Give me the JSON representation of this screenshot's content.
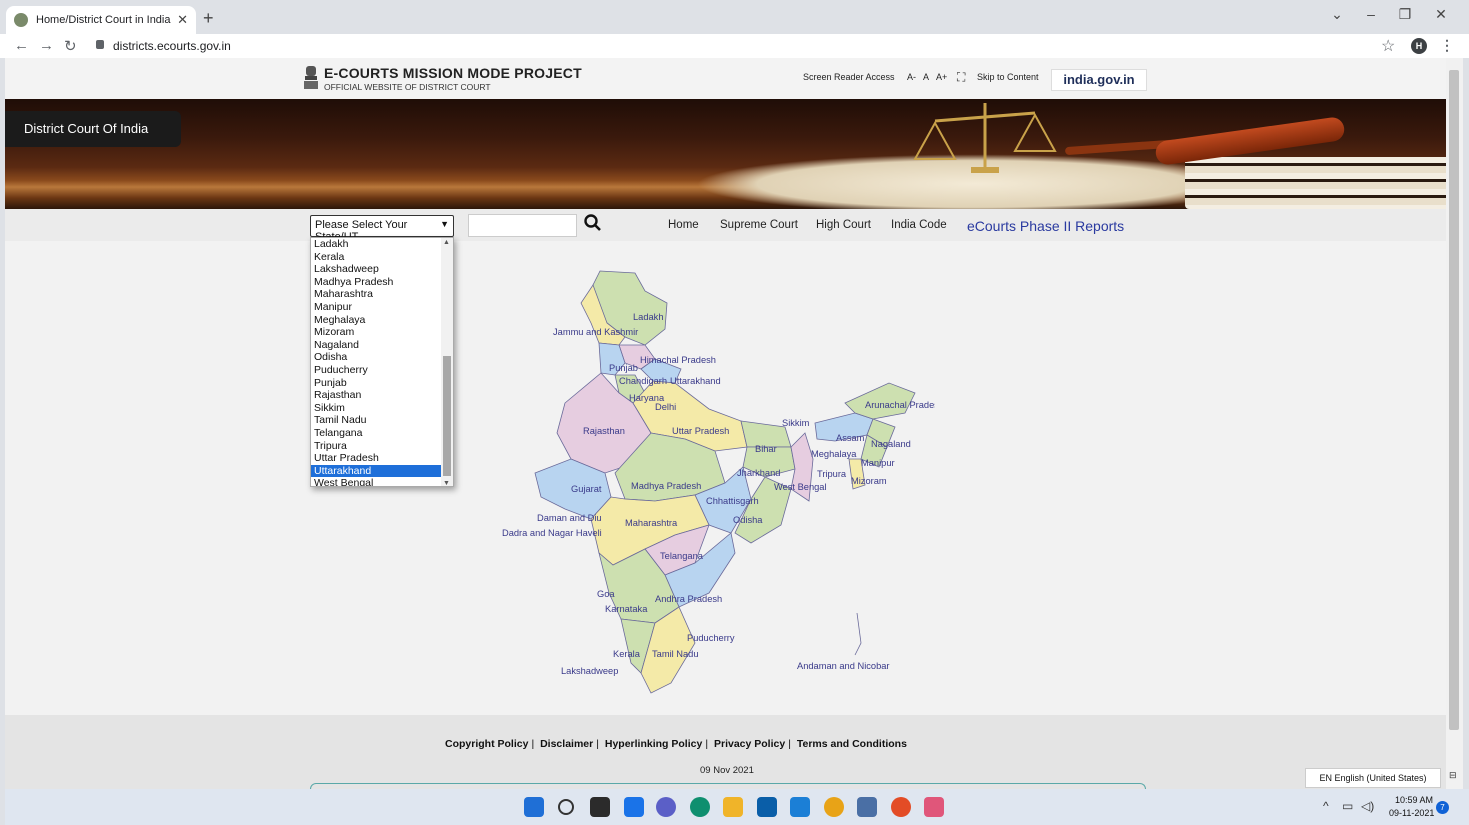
{
  "browser": {
    "tab_title": "Home/District Court in India | Of",
    "tab_close": "✕",
    "new_tab": "+",
    "url": "districts.ecourts.gov.in",
    "profile_initial": "H",
    "window_controls": [
      "⌄",
      "–",
      "❐",
      "✕"
    ]
  },
  "header": {
    "title": "E-COURTS MISSION MODE PROJECT",
    "subtitle": "OFFICIAL WEBSITE OF DISTRICT COURT",
    "screen_reader": "Screen Reader Access",
    "font_small": "A-",
    "font_normal": "A",
    "font_large": "A+",
    "skip_content": "Skip to Content",
    "india_gov": "india.gov.in"
  },
  "banner": {
    "title": "District Court Of India"
  },
  "nav": {
    "state_select": "Please Select Your State/UT",
    "search_placeholder": "",
    "links": [
      "Home",
      "Supreme Court",
      "High Court",
      "India Code"
    ],
    "reports": "eCourts Phase II Reports"
  },
  "dropdown": {
    "options": [
      "Ladakh",
      "Kerala",
      "Lakshadweep",
      "Madhya Pradesh",
      "Maharashtra",
      "Manipur",
      "Meghalaya",
      "Mizoram",
      "Nagaland",
      "Odisha",
      "Puducherry",
      "Punjab",
      "Rajasthan",
      "Sikkim",
      "Tamil Nadu",
      "Telangana",
      "Tripura",
      "Uttar Pradesh",
      "Uttarakhand",
      "West Bengal"
    ],
    "selected": "Uttarakhand"
  },
  "map_labels": [
    "Ladakh",
    "Jammu and Kashmir",
    "Himachal Pradesh",
    "Punjab",
    "Chandigarh",
    "Uttarakhand",
    "Haryana",
    "Delhi",
    "Arunachal Pradesh",
    "Rajasthan",
    "Uttar Pradesh",
    "Sikkim",
    "Assam",
    "Nagaland",
    "Bihar",
    "Meghalaya",
    "Manipur",
    "Jharkhand",
    "Tripura",
    "Gujarat",
    "Madhya Pradesh",
    "West Bengal",
    "Mizoram",
    "Chhattisgarh",
    "Daman and Diu",
    "Odisha",
    "Maharashtra",
    "Dadra and Nagar Haveli",
    "Telangana",
    "Goa",
    "Andhra Pradesh",
    "Karnataka",
    "Puducherry",
    "Kerala",
    "Tamil Nadu",
    "Lakshadweep",
    "Andaman and Nicobar"
  ],
  "footer": {
    "links": [
      "Copyright Policy",
      "Disclaimer",
      "Hyperlinking Policy",
      "Privacy Policy",
      "Terms and Conditions"
    ],
    "date": "09 Nov 2021"
  },
  "system": {
    "language": "EN English (United States)",
    "time": "10:59 AM",
    "date": "09-11-2021",
    "notifications": "7"
  },
  "colors": {
    "selected_option": "#1e6fd9",
    "reports_link": "#2a3aa0",
    "map_label": "#3a3a8a"
  }
}
